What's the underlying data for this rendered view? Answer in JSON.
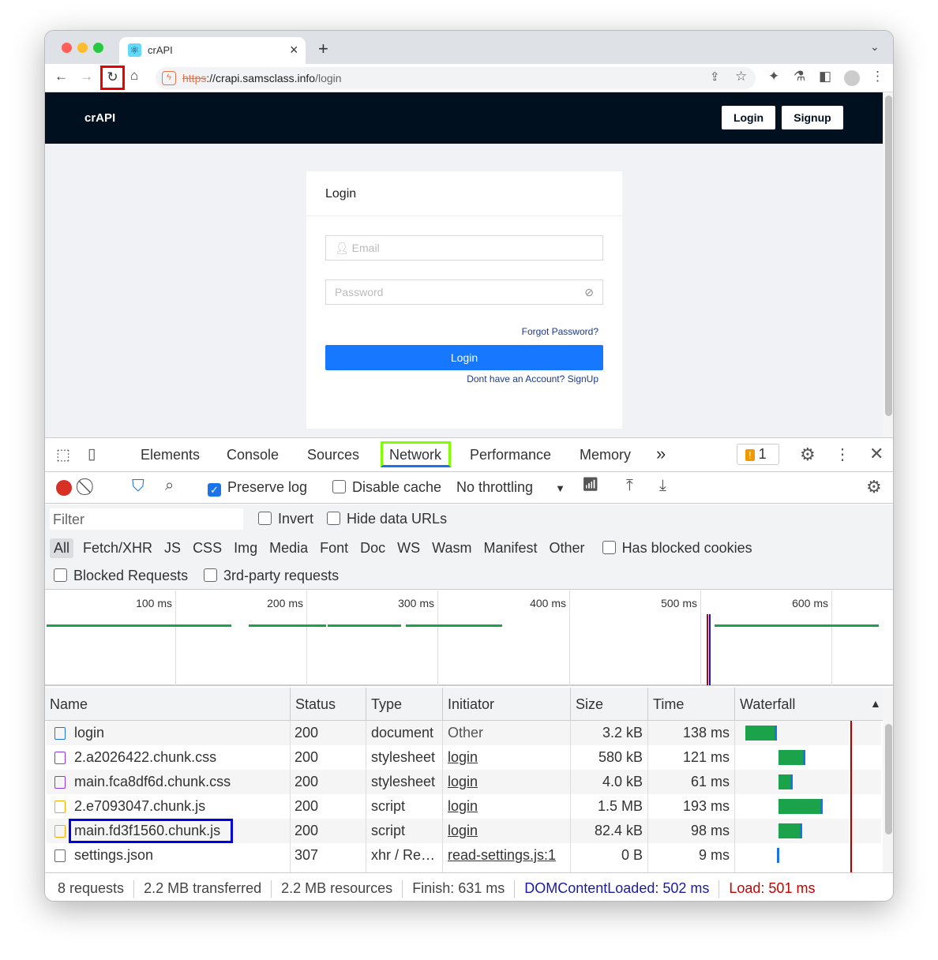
{
  "browser": {
    "tab_title": "crAPI",
    "url_scheme": "https",
    "url_host": "://crapi.samsclass.info",
    "url_path": "/login",
    "close": "×",
    "new_tab": "+"
  },
  "site": {
    "brand": "crAPI",
    "login_btn": "Login",
    "signup_btn": "Signup",
    "card_title": "Login",
    "email_placeholder": "Email",
    "password_placeholder": "Password",
    "forgot": "Forgot Password?",
    "submit": "Login",
    "signup_link": "Dont have an Account? SignUp"
  },
  "devtools": {
    "tabs": [
      "Elements",
      "Console",
      "Sources",
      "Network",
      "Performance",
      "Memory"
    ],
    "more": "»",
    "issues_count": "1",
    "preserve_log": "Preserve log",
    "disable_cache": "Disable cache",
    "throttling": "No throttling",
    "filter_placeholder": "Filter",
    "invert": "Invert",
    "hide_data_urls": "Hide data URLs",
    "types": [
      "All",
      "Fetch/XHR",
      "JS",
      "CSS",
      "Img",
      "Media",
      "Font",
      "Doc",
      "WS",
      "Wasm",
      "Manifest",
      "Other"
    ],
    "has_blocked_cookies": "Has blocked cookies",
    "blocked_requests": "Blocked Requests",
    "third_party": "3rd-party requests",
    "timeline_ticks": [
      "100 ms",
      "200 ms",
      "300 ms",
      "400 ms",
      "500 ms",
      "600 ms"
    ],
    "columns": [
      "Name",
      "Status",
      "Type",
      "Initiator",
      "Size",
      "Time",
      "Waterfall"
    ],
    "rows": [
      {
        "name": "login",
        "status": "200",
        "type": "document",
        "initiator": "Other",
        "size": "3.2 kB",
        "time": "138 ms",
        "icon": "document",
        "color": "#1a73e8"
      },
      {
        "name": "2.a2026422.chunk.css",
        "status": "200",
        "type": "stylesheet",
        "initiator": "login",
        "size": "580 kB",
        "time": "121 ms",
        "icon": "css",
        "color": "#9334e6"
      },
      {
        "name": "main.fca8df6d.chunk.css",
        "status": "200",
        "type": "stylesheet",
        "initiator": "login",
        "size": "4.0 kB",
        "time": "61 ms",
        "icon": "css",
        "color": "#9334e6"
      },
      {
        "name": "2.e7093047.chunk.js",
        "status": "200",
        "type": "script",
        "initiator": "login",
        "size": "1.5 MB",
        "time": "193 ms",
        "icon": "script",
        "color": "#f9ab00"
      },
      {
        "name": "main.fd3f1560.chunk.js",
        "status": "200",
        "type": "script",
        "initiator": "login",
        "size": "82.4 kB",
        "time": "98 ms",
        "icon": "script",
        "color": "#f9ab00"
      },
      {
        "name": "settings.json",
        "status": "307",
        "type": "xhr / Re…",
        "initiator": "read-settings.js:1",
        "size": "0 B",
        "time": "9 ms",
        "icon": "xhr",
        "color": "#666"
      }
    ],
    "footer": {
      "requests": "8 requests",
      "transferred": "2.2 MB transferred",
      "resources": "2.2 MB resources",
      "finish": "Finish: 631 ms",
      "dcl": "DOMContentLoaded: 502 ms",
      "load": "Load: 501 ms"
    }
  }
}
